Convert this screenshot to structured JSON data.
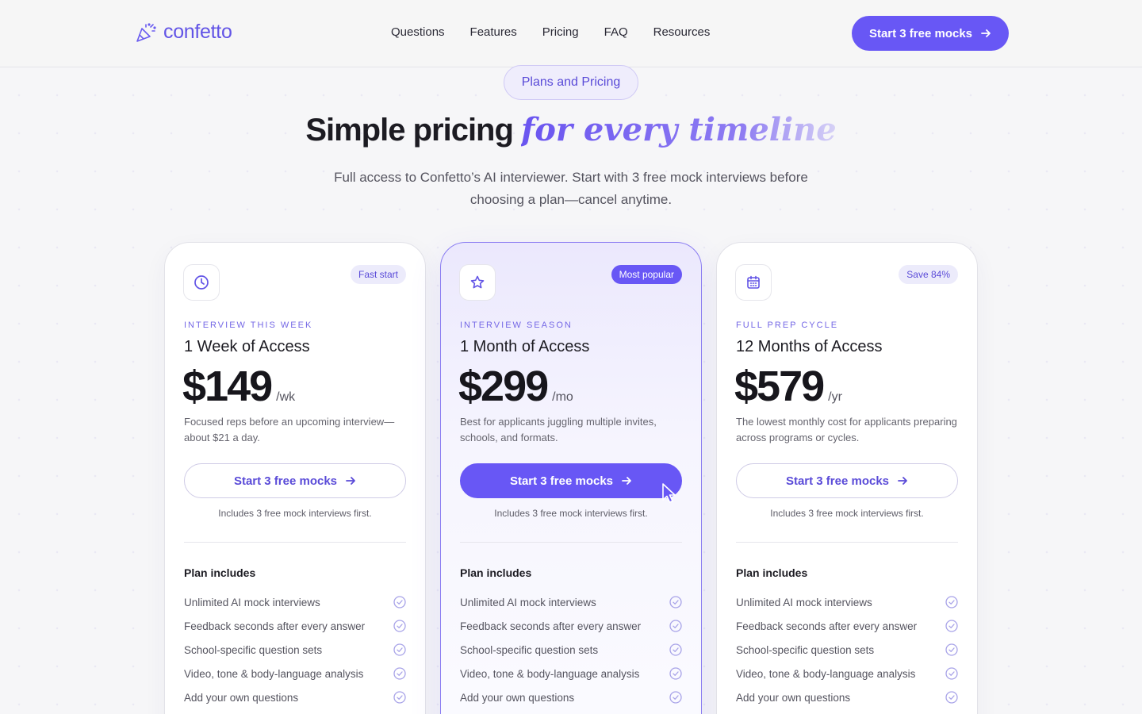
{
  "brand": {
    "name": "confetto"
  },
  "nav": {
    "items": [
      "Questions",
      "Features",
      "Pricing",
      "FAQ",
      "Resources"
    ],
    "cta_label": "Start 3 free mocks"
  },
  "hero": {
    "pill": "Plans and Pricing",
    "title_main": "Simple pricing",
    "title_accent": "for every timeline",
    "subtitle": "Full access to Confetto’s AI interviewer. Start with 3 free mock interviews before choosing a plan—cancel anytime."
  },
  "plans": [
    {
      "badge": "Fast start",
      "eyebrow": "Interview this week",
      "name": "1 Week of Access",
      "price": "$149",
      "period": "/wk",
      "description": "Focused reps before an upcoming interview—about $21 a day.",
      "button": "Start 3 free mocks",
      "note": "Includes 3 free mock interviews first.",
      "includes_title": "Plan includes",
      "features": [
        "Unlimited AI mock interviews",
        "Feedback seconds after every answer",
        "School-specific question sets",
        "Video, tone & body-language analysis",
        "Add your own questions"
      ]
    },
    {
      "badge": "Most popular",
      "eyebrow": "Interview season",
      "name": "1 Month of Access",
      "price": "$299",
      "period": "/mo",
      "description": "Best for applicants juggling multiple invites, schools, and formats.",
      "button": "Start 3 free mocks",
      "note": "Includes 3 free mock interviews first.",
      "includes_title": "Plan includes",
      "features": [
        "Unlimited AI mock interviews",
        "Feedback seconds after every answer",
        "School-specific question sets",
        "Video, tone & body-language analysis",
        "Add your own questions"
      ]
    },
    {
      "badge": "Save 84%",
      "eyebrow": "Full prep cycle",
      "name": "12 Months of Access",
      "price": "$579",
      "period": "/yr",
      "description": "The lowest monthly cost for applicants preparing across programs or cycles.",
      "button": "Start 3 free mocks",
      "note": "Includes 3 free mock interviews first.",
      "includes_title": "Plan includes",
      "features": [
        "Unlimited AI mock interviews",
        "Feedback seconds after every answer",
        "School-specific question sets",
        "Video, tone & body-language analysis",
        "Add your own questions"
      ]
    }
  ],
  "colors": {
    "accent": "#6857f5",
    "accent_text": "#5a4bd8",
    "background": "#f6f6f8"
  },
  "icons": [
    "confetti-icon",
    "arrow-right-icon",
    "clock-icon",
    "star-icon",
    "calendar-icon",
    "check-circle-icon",
    "mouse-cursor-icon"
  ]
}
